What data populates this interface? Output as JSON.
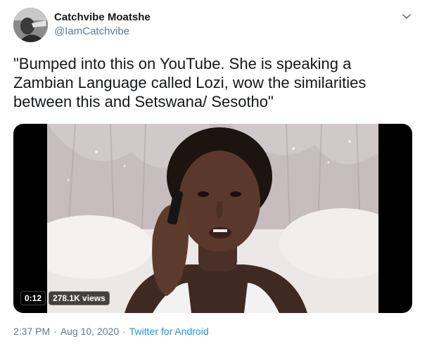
{
  "user": {
    "display_name": "Catchvibe Moatshe",
    "handle": "@IamCatchvibe"
  },
  "tweet": {
    "text": "\"Bumped into this on YouTube. She is speaking a Zambian Language called Lozi, wow the similarities between this and Setswana/ Sesotho\""
  },
  "media": {
    "duration": "0:12",
    "views": "278.1K views"
  },
  "meta": {
    "time": "2:37 PM",
    "separator": "·",
    "date": "Aug 10, 2020",
    "source": "Twitter for Android"
  },
  "icons": {
    "menu": "chevron-down-icon"
  },
  "colors": {
    "text": "#14171a",
    "secondary": "#657786",
    "link": "#1b95e0"
  }
}
